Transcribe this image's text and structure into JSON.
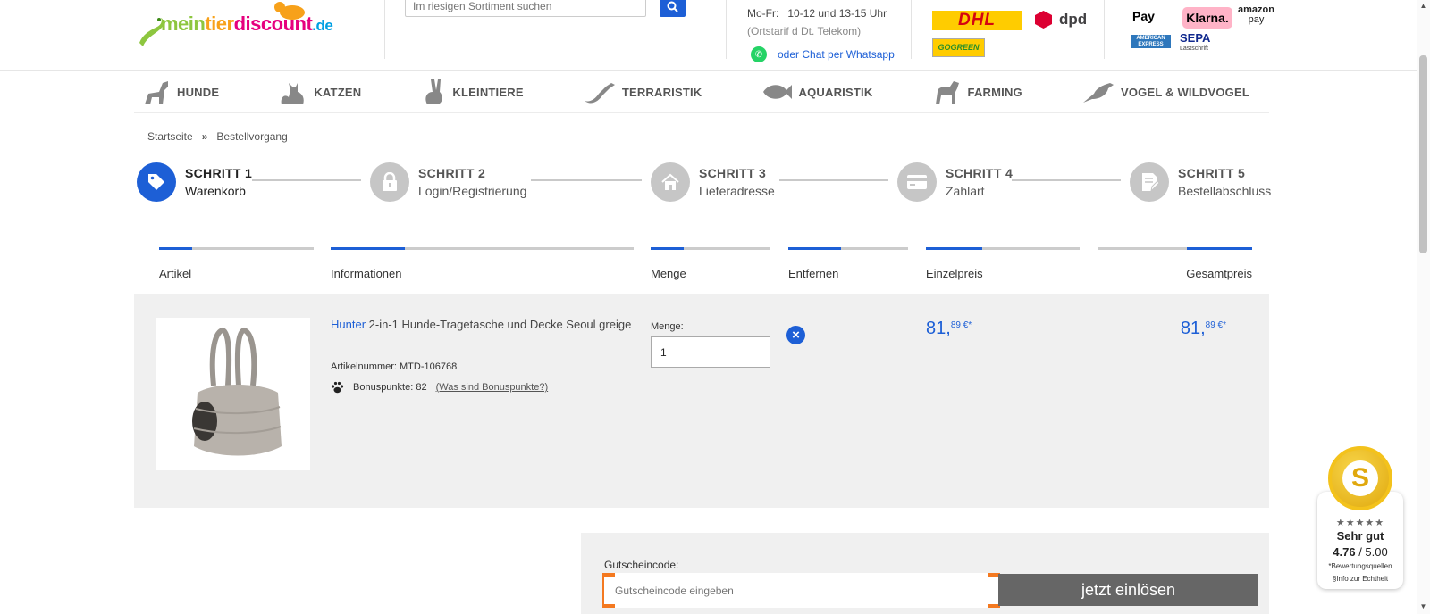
{
  "header": {
    "logo": {
      "part1": "mein",
      "part2": "tier",
      "part3": "discount",
      "tld": ".de"
    },
    "search_placeholder": "Im riesigen Sortiment suchen",
    "hours": {
      "days": "Mo-Fr:",
      "times": "10-12 und 13-15 Uhr",
      "note": "(Ortstarif d Dt. Telekom)"
    },
    "whatsapp_text": "oder Chat per Whatsapp",
    "shipping": {
      "dhl": "DHL",
      "dpd": "dpd",
      "gogreen": "GOGREEN"
    },
    "payment": {
      "apple_pay": "Pay",
      "klarna": "Klarna.",
      "amazon_pay": "amazon",
      "amazon_pay_sub": "pay",
      "amex": "AMERICAN EXPRESS",
      "sepa": "SEPA",
      "sepa_sub": "Lastschrift"
    }
  },
  "nav": [
    {
      "label": "HUNDE",
      "icon": "dog-icon"
    },
    {
      "label": "KATZEN",
      "icon": "cat-icon"
    },
    {
      "label": "KLEINTIERE",
      "icon": "rabbit-icon"
    },
    {
      "label": "TERRARISTIK",
      "icon": "lizard-icon"
    },
    {
      "label": "AQUARISTIK",
      "icon": "fish-icon"
    },
    {
      "label": "FARMING",
      "icon": "horse-icon"
    },
    {
      "label": "VOGEL & WILDVOGEL",
      "icon": "bird-icon"
    }
  ],
  "breadcrumb": {
    "home": "Startseite",
    "separator": "»",
    "current": "Bestellvorgang"
  },
  "steps": [
    {
      "title": "SCHRITT 1",
      "label": "Warenkorb",
      "icon": "tag-icon",
      "active": true
    },
    {
      "title": "SCHRITT 2",
      "label": "Login/Registrierung",
      "icon": "lock-icon",
      "active": false
    },
    {
      "title": "SCHRITT 3",
      "label": "Lieferadresse",
      "icon": "house-icon",
      "active": false
    },
    {
      "title": "SCHRITT 4",
      "label": "Zahlart",
      "icon": "credit-card-icon",
      "active": false
    },
    {
      "title": "SCHRITT 5",
      "label": "Bestellabschluss",
      "icon": "document-edit-icon",
      "active": false
    }
  ],
  "cart": {
    "columns": [
      "Artikel",
      "Informationen",
      "Menge",
      "Entfernen",
      "Einzelpreis",
      "Gesamtpreis"
    ],
    "items": [
      {
        "brand": "Hunter",
        "name": "2-in-1 Hunde-Tragetasche und Decke Seoul greige",
        "article_number": "Artikelnummer: MTD-106768",
        "bonus_points": "Bonuspunkte: 82",
        "bonus_link": "(Was sind Bonuspunkte?)",
        "quantity_label": "Menge:",
        "quantity": "1",
        "unit_price": {
          "main": "81,",
          "cents": "89 €*"
        },
        "total_price": {
          "main": "81,",
          "cents": "89 €*"
        }
      }
    ]
  },
  "coupon": {
    "label": "Gutscheincode:",
    "placeholder": "Gutscheincode eingeben",
    "button": "jetzt einlösen"
  },
  "shopvote": {
    "letter": "S",
    "stars": "★★★★★",
    "verdict": "Sehr gut",
    "score": "4.76",
    "score_max": " / 5.00",
    "note1": "*Bewertungsquellen",
    "note2": "§Info zur Echtheit"
  },
  "colors": {
    "accent": "#1d5fd6",
    "coupon_border": "#f47920",
    "coupon_button": "#666666",
    "row_bg": "#f0f0f0"
  }
}
